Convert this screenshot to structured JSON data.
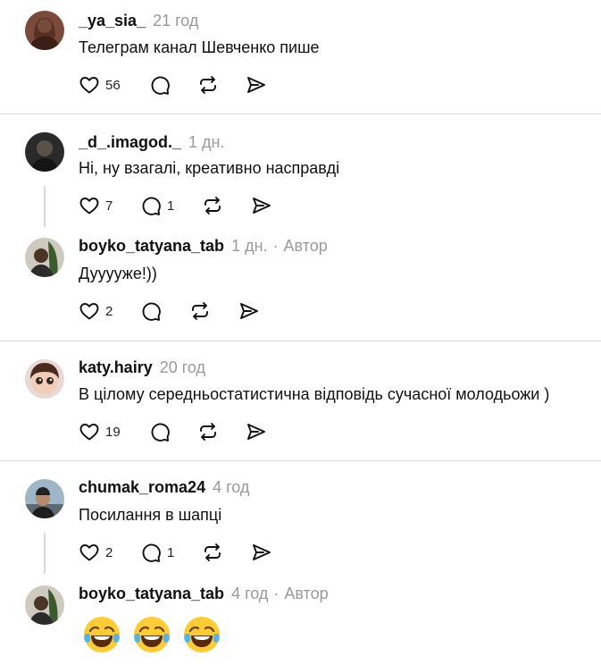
{
  "comments": [
    {
      "user": "_ya_sia_",
      "time": "21 год",
      "text": "Телеграм канал Шевченко пише",
      "likes": "56",
      "replies": "",
      "author": ""
    },
    {
      "user": "_d_.imagod._",
      "time": "1 дн.",
      "text": "Ні, ну взагалі, креативно насправді",
      "likes": "7",
      "replies": "1",
      "author": ""
    },
    {
      "user": "boyko_tatyana_tab",
      "time": "1 дн.",
      "text": "Дууууже!))",
      "likes": "2",
      "replies": "",
      "author": "Автор"
    },
    {
      "user": "katy.hairy",
      "time": "20 год",
      "text": "В цілому середньостатистична відповідь сучасної молодьожи )",
      "likes": "19",
      "replies": "",
      "author": ""
    },
    {
      "user": "chumak_roma24",
      "time": "4 год",
      "text": "Посилання в шапці",
      "likes": "2",
      "replies": "1",
      "author": ""
    },
    {
      "user": "boyko_tatyana_tab",
      "time": "4 год",
      "text": "",
      "likes": "",
      "replies": "",
      "author": "Автор",
      "emojis": [
        "face-with-tears-of-joy",
        "face-with-tears-of-joy",
        "face-with-tears-of-joy"
      ]
    }
  ],
  "separator": "·",
  "icons": {
    "like": "heart-icon",
    "reply": "comment-bubble-icon",
    "repost": "repost-icon",
    "share": "send-icon"
  },
  "colors": {
    "muted": "#9a9a9a",
    "divider": "#dbdbdb",
    "thread": "#d9d9d9"
  }
}
